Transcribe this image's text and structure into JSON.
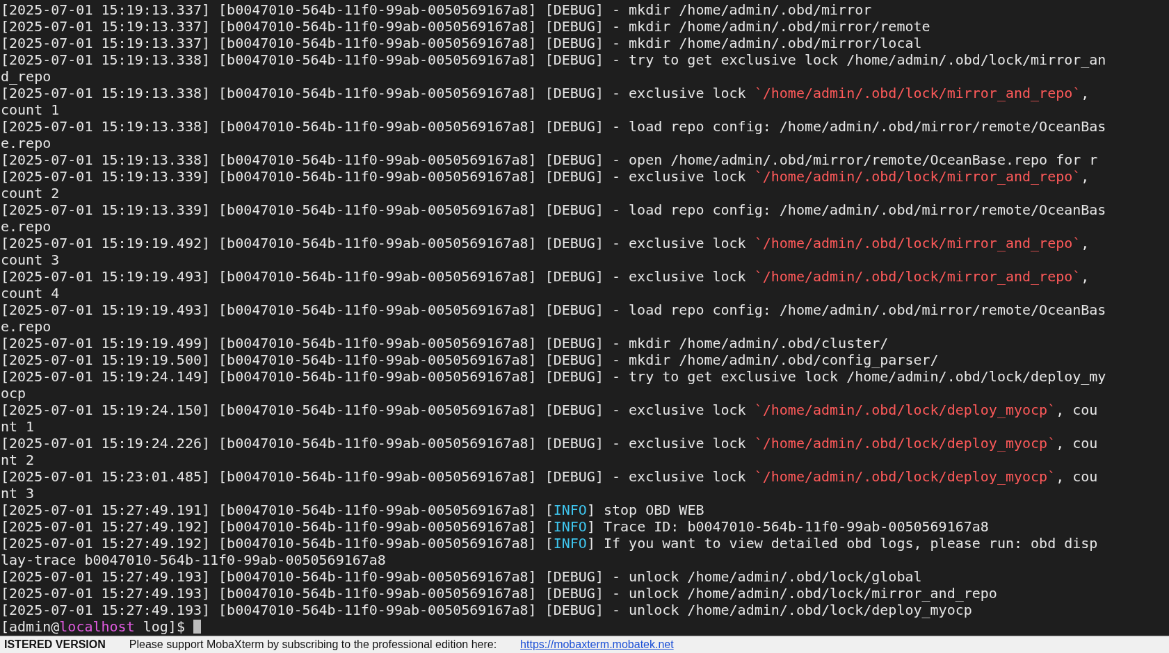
{
  "terminal": {
    "lines": [
      {
        "segments": [
          {
            "kind": "plain",
            "text": "[2025-07-01 15:19:13.337] [b0047010-564b-11f0-99ab-0050569167a8] [DEBUG] - mkdir /home/admin/.obd/mirror"
          }
        ]
      },
      {
        "segments": [
          {
            "kind": "plain",
            "text": "[2025-07-01 15:19:13.337] [b0047010-564b-11f0-99ab-0050569167a8] [DEBUG] - mkdir /home/admin/.obd/mirror/remote"
          }
        ]
      },
      {
        "segments": [
          {
            "kind": "plain",
            "text": "[2025-07-01 15:19:13.337] [b0047010-564b-11f0-99ab-0050569167a8] [DEBUG] - mkdir /home/admin/.obd/mirror/local"
          }
        ]
      },
      {
        "segments": [
          {
            "kind": "plain",
            "text": "[2025-07-01 15:19:13.338] [b0047010-564b-11f0-99ab-0050569167a8] [DEBUG] - try to get exclusive lock /home/admin/.obd/lock/mirror_and_repo"
          }
        ]
      },
      {
        "segments": [
          {
            "kind": "plain",
            "text": "[2025-07-01 15:19:13.338] [b0047010-564b-11f0-99ab-0050569167a8] [DEBUG] - exclusive lock "
          },
          {
            "kind": "path",
            "text": "`/home/admin/.obd/lock/mirror_and_repo`"
          },
          {
            "kind": "plain",
            "text": ", count 1"
          }
        ]
      },
      {
        "segments": [
          {
            "kind": "plain",
            "text": "[2025-07-01 15:19:13.338] [b0047010-564b-11f0-99ab-0050569167a8] [DEBUG] - load repo config: /home/admin/.obd/mirror/remote/OceanBase.repo"
          }
        ]
      },
      {
        "segments": [
          {
            "kind": "plain",
            "text": "[2025-07-01 15:19:13.338] [b0047010-564b-11f0-99ab-0050569167a8] [DEBUG] - open /home/admin/.obd/mirror/remote/OceanBase.repo for r"
          }
        ]
      },
      {
        "segments": [
          {
            "kind": "plain",
            "text": "[2025-07-01 15:19:13.339] [b0047010-564b-11f0-99ab-0050569167a8] [DEBUG] - exclusive lock "
          },
          {
            "kind": "path",
            "text": "`/home/admin/.obd/lock/mirror_and_repo`"
          },
          {
            "kind": "plain",
            "text": ", count 2"
          }
        ]
      },
      {
        "segments": [
          {
            "kind": "plain",
            "text": "[2025-07-01 15:19:13.339] [b0047010-564b-11f0-99ab-0050569167a8] [DEBUG] - load repo config: /home/admin/.obd/mirror/remote/OceanBase.repo"
          }
        ]
      },
      {
        "segments": [
          {
            "kind": "plain",
            "text": "[2025-07-01 15:19:19.492] [b0047010-564b-11f0-99ab-0050569167a8] [DEBUG] - exclusive lock "
          },
          {
            "kind": "path",
            "text": "`/home/admin/.obd/lock/mirror_and_repo`"
          },
          {
            "kind": "plain",
            "text": ", count 3"
          }
        ]
      },
      {
        "segments": [
          {
            "kind": "plain",
            "text": "[2025-07-01 15:19:19.493] [b0047010-564b-11f0-99ab-0050569167a8] [DEBUG] - exclusive lock "
          },
          {
            "kind": "path",
            "text": "`/home/admin/.obd/lock/mirror_and_repo`"
          },
          {
            "kind": "plain",
            "text": ", count 4"
          }
        ]
      },
      {
        "segments": [
          {
            "kind": "plain",
            "text": "[2025-07-01 15:19:19.493] [b0047010-564b-11f0-99ab-0050569167a8] [DEBUG] - load repo config: /home/admin/.obd/mirror/remote/OceanBase.repo"
          }
        ]
      },
      {
        "segments": [
          {
            "kind": "plain",
            "text": "[2025-07-01 15:19:19.499] [b0047010-564b-11f0-99ab-0050569167a8] [DEBUG] - mkdir /home/admin/.obd/cluster/"
          }
        ]
      },
      {
        "segments": [
          {
            "kind": "plain",
            "text": "[2025-07-01 15:19:19.500] [b0047010-564b-11f0-99ab-0050569167a8] [DEBUG] - mkdir /home/admin/.obd/config_parser/"
          }
        ]
      },
      {
        "segments": [
          {
            "kind": "plain",
            "text": "[2025-07-01 15:19:24.149] [b0047010-564b-11f0-99ab-0050569167a8] [DEBUG] - try to get exclusive lock /home/admin/.obd/lock/deploy_myocp"
          }
        ]
      },
      {
        "segments": [
          {
            "kind": "plain",
            "text": "[2025-07-01 15:19:24.150] [b0047010-564b-11f0-99ab-0050569167a8] [DEBUG] - exclusive lock "
          },
          {
            "kind": "path",
            "text": "`/home/admin/.obd/lock/deploy_myocp`"
          },
          {
            "kind": "plain",
            "text": ", count 1"
          }
        ]
      },
      {
        "segments": [
          {
            "kind": "plain",
            "text": "[2025-07-01 15:19:24.226] [b0047010-564b-11f0-99ab-0050569167a8] [DEBUG] - exclusive lock "
          },
          {
            "kind": "path",
            "text": "`/home/admin/.obd/lock/deploy_myocp`"
          },
          {
            "kind": "plain",
            "text": ", count 2"
          }
        ]
      },
      {
        "segments": [
          {
            "kind": "plain",
            "text": "[2025-07-01 15:23:01.485] [b0047010-564b-11f0-99ab-0050569167a8] [DEBUG] - exclusive lock "
          },
          {
            "kind": "path",
            "text": "`/home/admin/.obd/lock/deploy_myocp`"
          },
          {
            "kind": "plain",
            "text": ", count 3"
          }
        ]
      },
      {
        "segments": [
          {
            "kind": "plain",
            "text": "[2025-07-01 15:27:49.191] [b0047010-564b-11f0-99ab-0050569167a8] ["
          },
          {
            "kind": "info",
            "text": "INFO"
          },
          {
            "kind": "plain",
            "text": "] stop OBD WEB"
          }
        ]
      },
      {
        "segments": [
          {
            "kind": "plain",
            "text": "[2025-07-01 15:27:49.192] [b0047010-564b-11f0-99ab-0050569167a8] ["
          },
          {
            "kind": "info",
            "text": "INFO"
          },
          {
            "kind": "plain",
            "text": "] Trace ID: b0047010-564b-11f0-99ab-0050569167a8"
          }
        ]
      },
      {
        "segments": [
          {
            "kind": "plain",
            "text": "[2025-07-01 15:27:49.192] [b0047010-564b-11f0-99ab-0050569167a8] ["
          },
          {
            "kind": "info",
            "text": "INFO"
          },
          {
            "kind": "plain",
            "text": "] If you want to view detailed obd logs, please run: obd display-trace b0047010-564b-11f0-99ab-0050569167a8"
          }
        ]
      },
      {
        "segments": [
          {
            "kind": "plain",
            "text": "[2025-07-01 15:27:49.193] [b0047010-564b-11f0-99ab-0050569167a8] [DEBUG] - unlock /home/admin/.obd/lock/global"
          }
        ]
      },
      {
        "segments": [
          {
            "kind": "plain",
            "text": "[2025-07-01 15:27:49.193] [b0047010-564b-11f0-99ab-0050569167a8] [DEBUG] - unlock /home/admin/.obd/lock/mirror_and_repo"
          }
        ]
      },
      {
        "segments": [
          {
            "kind": "plain",
            "text": "[2025-07-01 15:27:49.193] [b0047010-564b-11f0-99ab-0050569167a8] [DEBUG] - unlock /home/admin/.obd/lock/deploy_myocp"
          }
        ]
      }
    ],
    "prompt": {
      "segments": [
        {
          "kind": "plain",
          "text": "[admin@"
        },
        {
          "kind": "host",
          "text": "localhost"
        },
        {
          "kind": "plain",
          "text": " log]$ "
        }
      ]
    }
  },
  "status_bar": {
    "label": "ISTERED VERSION",
    "message": "Please support MobaXterm by subscribing to the professional edition here:",
    "link": "https://mobaxterm.mobatek.net"
  }
}
